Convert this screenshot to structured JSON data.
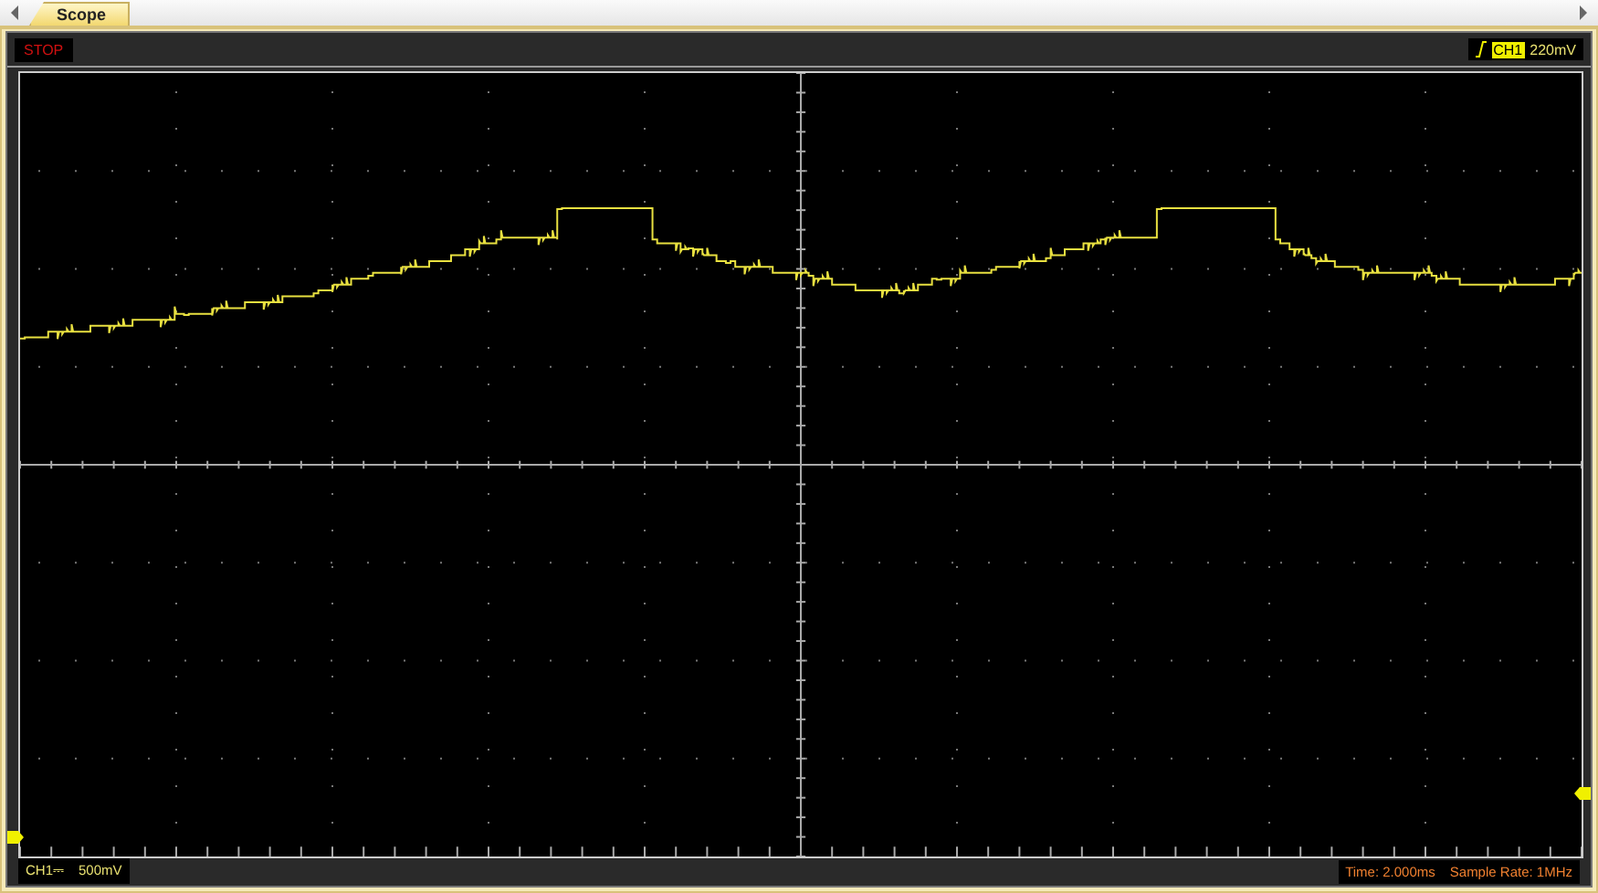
{
  "tabs": [
    {
      "label": "Scope",
      "selected": true
    }
  ],
  "scope": {
    "run_state": "STOP",
    "trigger": {
      "channel": "CH1",
      "level": "220mV"
    },
    "channel": {
      "name": "CH1",
      "coupling": "⎓",
      "scale": "500mV"
    },
    "time": "Time: 2.000ms",
    "sample_rate": "Sample Rate: 1MHz"
  }
}
